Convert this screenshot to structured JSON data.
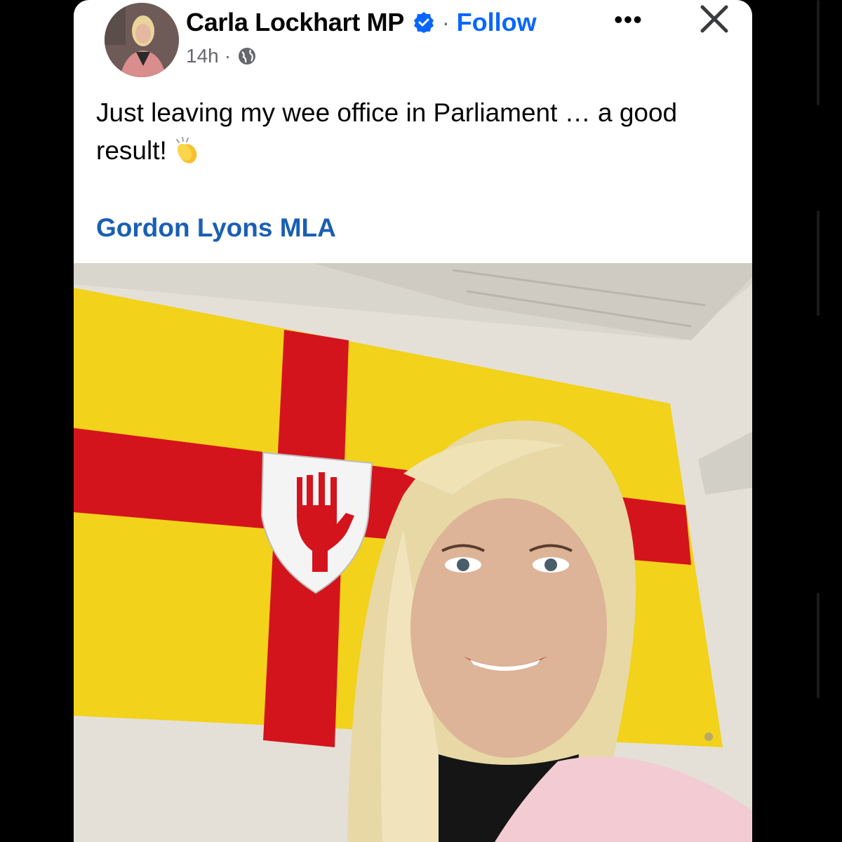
{
  "post": {
    "author": "Carla Lockhart MP",
    "separator": "·",
    "follow_label": "Follow",
    "more_label": "•••",
    "time": "14h",
    "meta_separator": "·",
    "visibility_icon": "globe-icon",
    "verified_icon": "verified-badge-icon",
    "close_icon": "close-icon",
    "text": "Just leaving my wee office in Parliament … a good result!",
    "emoji": "clapping-hands-icon",
    "tagged": "Gordon Lyons MLA"
  },
  "colors": {
    "link": "#0866ff",
    "tag": "#1a5fb4",
    "flag_yellow": "#f2d21a",
    "flag_red": "#d4141d"
  }
}
